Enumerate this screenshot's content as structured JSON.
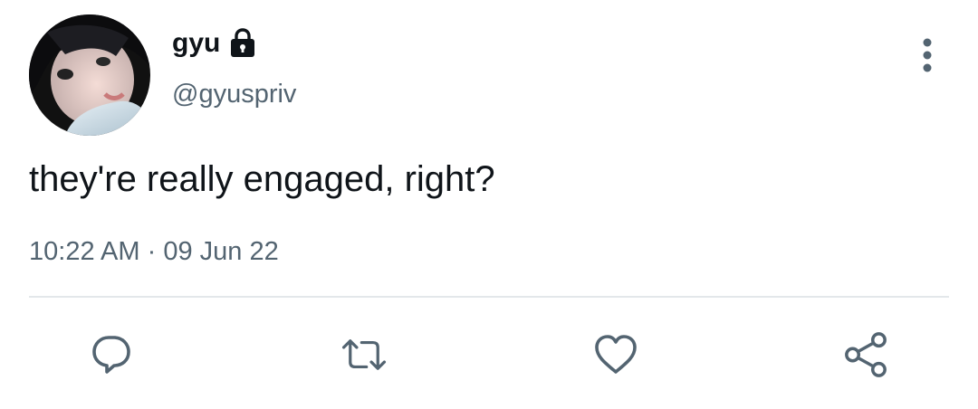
{
  "author": {
    "display_name": "gyu",
    "handle": "@gyuspriv",
    "protected_icon": "lock-icon",
    "avatar": "profile-photo"
  },
  "tweet": {
    "text": "they're really engaged, right?",
    "time": "10:22 AM",
    "separator": "·",
    "date": "09 Jun 22"
  },
  "actions": {
    "reply_icon": "reply-icon",
    "retweet_icon": "retweet-icon",
    "like_icon": "heart-icon",
    "share_icon": "share-icon",
    "more_icon": "more-vertical-icon"
  },
  "colors": {
    "text_primary": "#0f1419",
    "text_secondary": "#536471",
    "icon": "#536471",
    "divider": "#e3e7ea"
  }
}
